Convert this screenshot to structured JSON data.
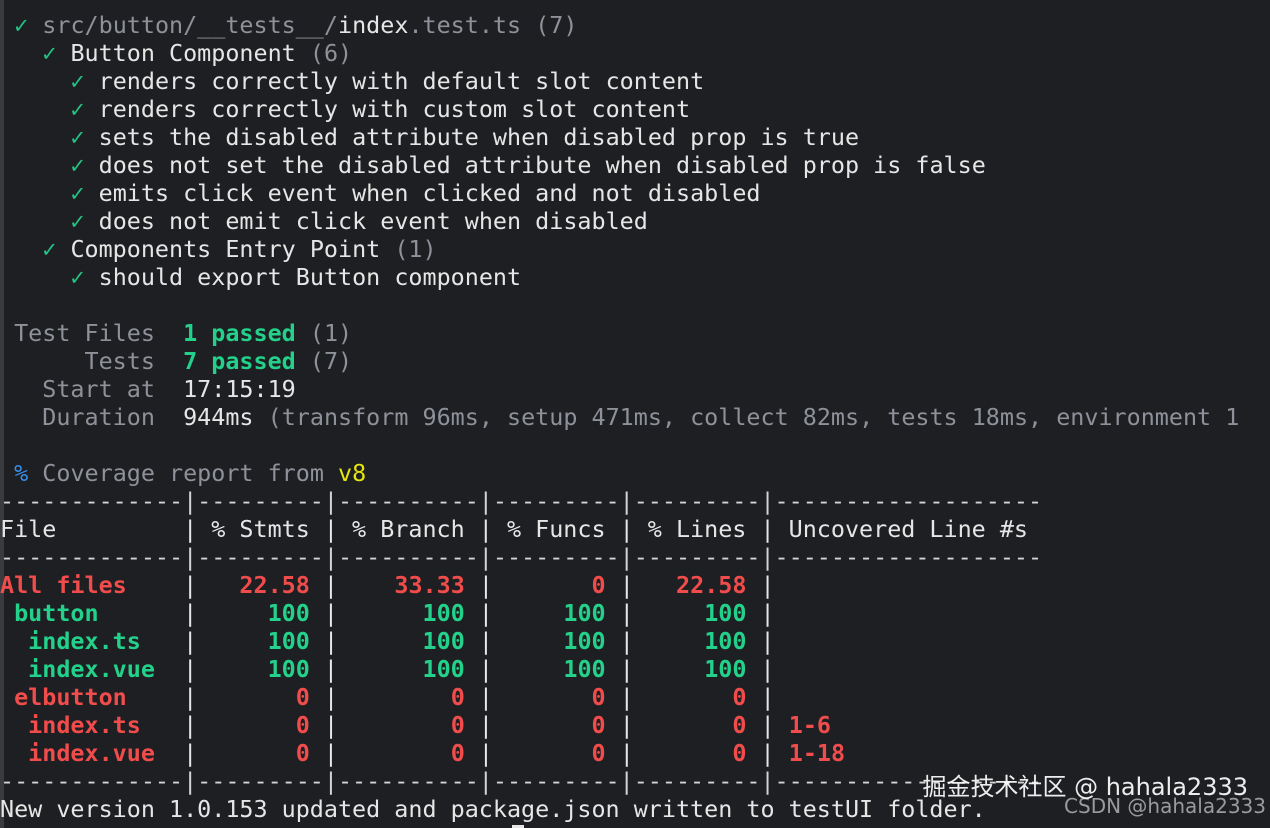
{
  "tests": {
    "file": {
      "check": "✓",
      "path_prefix": "src/button/__tests__/",
      "path_name": "index",
      "path_ext": ".test.ts",
      "count": "(7)"
    },
    "suite1": {
      "check": "✓",
      "name": "Button Component",
      "count": "(6)"
    },
    "cases1": [
      {
        "check": "✓",
        "text": "renders correctly with default slot content"
      },
      {
        "check": "✓",
        "text": "renders correctly with custom slot content"
      },
      {
        "check": "✓",
        "text": "sets the disabled attribute when disabled prop is true"
      },
      {
        "check": "✓",
        "text": "does not set the disabled attribute when disabled prop is false"
      },
      {
        "check": "✓",
        "text": "emits click event when clicked and not disabled"
      },
      {
        "check": "✓",
        "text": "does not emit click event when disabled"
      }
    ],
    "suite2": {
      "check": "✓",
      "name": "Components Entry Point",
      "count": "(1)"
    },
    "cases2": [
      {
        "check": "✓",
        "text": "should export Button component"
      }
    ]
  },
  "summary": {
    "test_files_label": "Test Files",
    "test_files_passed": "1 passed",
    "test_files_total": "(1)",
    "tests_label": "Tests",
    "tests_passed": "7 passed",
    "tests_total": "(7)",
    "start_label": "Start at",
    "start_value": "17:15:19",
    "duration_label": "Duration",
    "duration_value": "944ms",
    "duration_detail": "(transform 96ms, setup 471ms, collect 82ms, tests 18ms, environment 1"
  },
  "coverage": {
    "percent_sign": "%",
    "title": "Coverage report from",
    "provider": "v8",
    "rule_line": "-------------|---------|----------|---------|---------|-------------------",
    "header_line": "File         | % Stmts | % Branch | % Funcs | % Lines | Uncovered Line #s",
    "rows": [
      {
        "file": "All files",
        "indent": "",
        "stmts": "22.58",
        "branch": "33.33",
        "funcs": "0",
        "lines": "22.58",
        "uncovered": "",
        "color": "red"
      },
      {
        "file": "button",
        "indent": " ",
        "stmts": "100",
        "branch": "100",
        "funcs": "100",
        "lines": "100",
        "uncovered": "",
        "color": "green"
      },
      {
        "file": "index.ts",
        "indent": "  ",
        "stmts": "100",
        "branch": "100",
        "funcs": "100",
        "lines": "100",
        "uncovered": "",
        "color": "green"
      },
      {
        "file": "index.vue",
        "indent": "  ",
        "stmts": "100",
        "branch": "100",
        "funcs": "100",
        "lines": "100",
        "uncovered": "",
        "color": "green"
      },
      {
        "file": "elbutton",
        "indent": " ",
        "stmts": "0",
        "branch": "0",
        "funcs": "0",
        "lines": "0",
        "uncovered": "",
        "color": "red"
      },
      {
        "file": "index.ts",
        "indent": "  ",
        "stmts": "0",
        "branch": "0",
        "funcs": "0",
        "lines": "0",
        "uncovered": "1-6",
        "color": "red"
      },
      {
        "file": "index.vue",
        "indent": "  ",
        "stmts": "0",
        "branch": "0",
        "funcs": "0",
        "lines": "0",
        "uncovered": "1-18",
        "color": "red"
      }
    ]
  },
  "footer": {
    "message": "New version 1.0.153 updated and package.json written to testUI folder."
  },
  "watermark": {
    "primary": "掘金技术社区 @ hahala2333",
    "secondary": "CSDN @hahala2333"
  },
  "colors": {
    "background": "#1e1f22",
    "check": "#23c483",
    "pass": "#23d18b",
    "fail": "#f14c4c",
    "provider": "#e5e510",
    "percent": "#3b8eea"
  }
}
